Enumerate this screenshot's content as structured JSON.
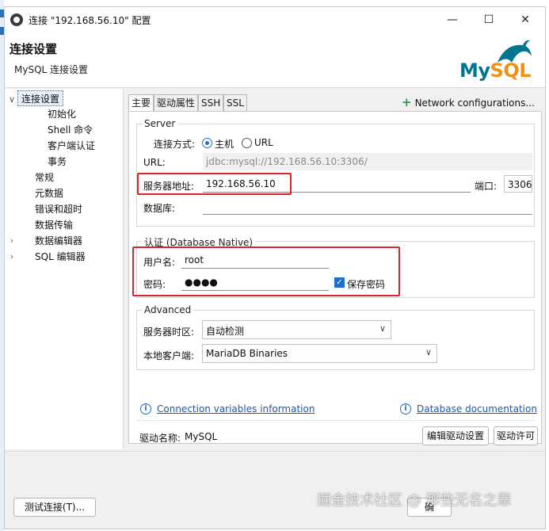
{
  "window": {
    "title": "连接 \"192.168.56.10\" 配置",
    "minimize_glyph": "—",
    "maximize_glyph": "☐",
    "close_glyph": "✕"
  },
  "header": {
    "title": "连接设置",
    "subtitle": "MySQL 连接设置",
    "logo_my": "My",
    "logo_sql": "SQL"
  },
  "sidebar": {
    "items": [
      {
        "label": "连接设置",
        "arrow": "∨",
        "selected": true
      },
      {
        "label": "初始化"
      },
      {
        "label": "Shell 命令"
      },
      {
        "label": "客户端认证"
      },
      {
        "label": "事务"
      },
      {
        "label": "常规"
      },
      {
        "label": "元数据"
      },
      {
        "label": "错误和超时"
      },
      {
        "label": "数据传输"
      },
      {
        "label": "数据编辑器",
        "arrow": "›"
      },
      {
        "label": "SQL 编辑器",
        "arrow": "›"
      }
    ]
  },
  "tabs": [
    {
      "label": "主要",
      "active": true
    },
    {
      "label": "驱动属性"
    },
    {
      "label": "SSH"
    },
    {
      "label": "SSL"
    }
  ],
  "network_config": {
    "plus": "+",
    "label": "Network configurations..."
  },
  "server": {
    "group_label": "Server",
    "conn_method_label": "连接方式:",
    "options": [
      "主机",
      "URL"
    ],
    "selected": "主机",
    "url_label": "URL:",
    "url_value": "jdbc:mysql://192.168.56.10:3306/",
    "host_label": "服务器地址:",
    "host_value": "192.168.56.10",
    "port_label": "端口:",
    "port_value": "3306",
    "db_label": "数据库:",
    "db_value": ""
  },
  "auth": {
    "group_label": "认证 (Database Native)",
    "user_label": "用户名:",
    "user_value": "root",
    "password_label": "密码:",
    "password_value": "●●●●",
    "save_password_label": "保存密码",
    "save_password_checked": true
  },
  "advanced": {
    "group_label": "Advanced",
    "timezone_label": "服务器时区:",
    "timezone_value": "自动检测",
    "client_label": "本地客户端:",
    "client_value": "MariaDB Binaries"
  },
  "links": {
    "info_glyph": "i",
    "conn_vars": "Connection variables information",
    "db_docs": "Database documentation"
  },
  "driver": {
    "name_label": "驱动名称:",
    "name_value": "MySQL",
    "edit_button": "编辑驱动设置",
    "license_button": "驱动许可"
  },
  "footer": {
    "test_button": "测试连接(T)...",
    "ok_button": "确",
    "watermark": "掘金技术社区 @ 那些无名之辈"
  },
  "colors": {
    "accent": "#1d6fc9",
    "highlight_red": "#d9252e",
    "mysql_blue": "#00758f",
    "mysql_orange": "#f29111"
  }
}
